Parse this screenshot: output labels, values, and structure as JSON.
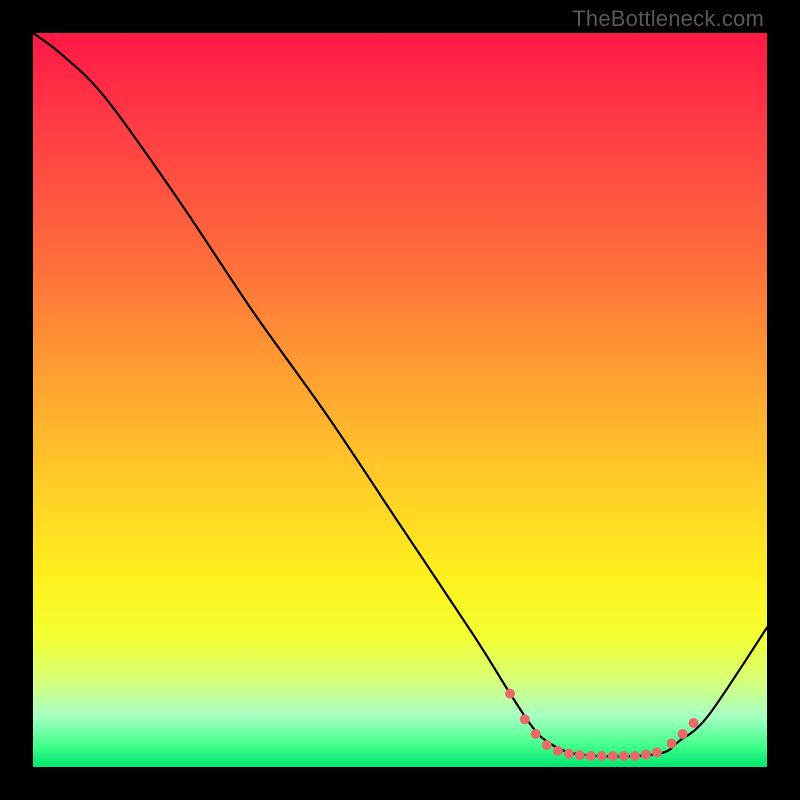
{
  "watermark": "TheBottleneck.com",
  "chart_data": {
    "type": "line",
    "title": "",
    "xlabel": "",
    "ylabel": "",
    "xlim": [
      0,
      100
    ],
    "ylim": [
      0,
      100
    ],
    "grid": false,
    "series": [
      {
        "name": "bottleneck-curve",
        "x": [
          0,
          4,
          10,
          20,
          30,
          40,
          50,
          60,
          65,
          68,
          70,
          73,
          77,
          82,
          86,
          88,
          92,
          100
        ],
        "values": [
          100,
          97,
          91,
          77,
          62,
          48,
          33,
          18,
          10,
          5.5,
          3.5,
          2.0,
          1.5,
          1.5,
          2.0,
          3.5,
          7,
          19
        ]
      }
    ],
    "markers": {
      "name": "trough-markers",
      "color": "#e86a66",
      "radius_px": 5,
      "points": [
        {
          "x": 65.0,
          "y": 10.0
        },
        {
          "x": 67.0,
          "y": 6.5
        },
        {
          "x": 68.5,
          "y": 4.5
        },
        {
          "x": 70.0,
          "y": 3.0
        },
        {
          "x": 71.5,
          "y": 2.2
        },
        {
          "x": 73.0,
          "y": 1.8
        },
        {
          "x": 74.5,
          "y": 1.6
        },
        {
          "x": 76.0,
          "y": 1.5
        },
        {
          "x": 77.5,
          "y": 1.5
        },
        {
          "x": 79.0,
          "y": 1.5
        },
        {
          "x": 80.5,
          "y": 1.5
        },
        {
          "x": 82.0,
          "y": 1.5
        },
        {
          "x": 83.5,
          "y": 1.7
        },
        {
          "x": 85.0,
          "y": 2.0
        },
        {
          "x": 87.0,
          "y": 3.2
        },
        {
          "x": 88.5,
          "y": 4.5
        },
        {
          "x": 90.0,
          "y": 6.0
        }
      ]
    },
    "background_gradient": {
      "top": "#ff1846",
      "mid": "#fff01e",
      "bottom": "#00e66f"
    }
  }
}
